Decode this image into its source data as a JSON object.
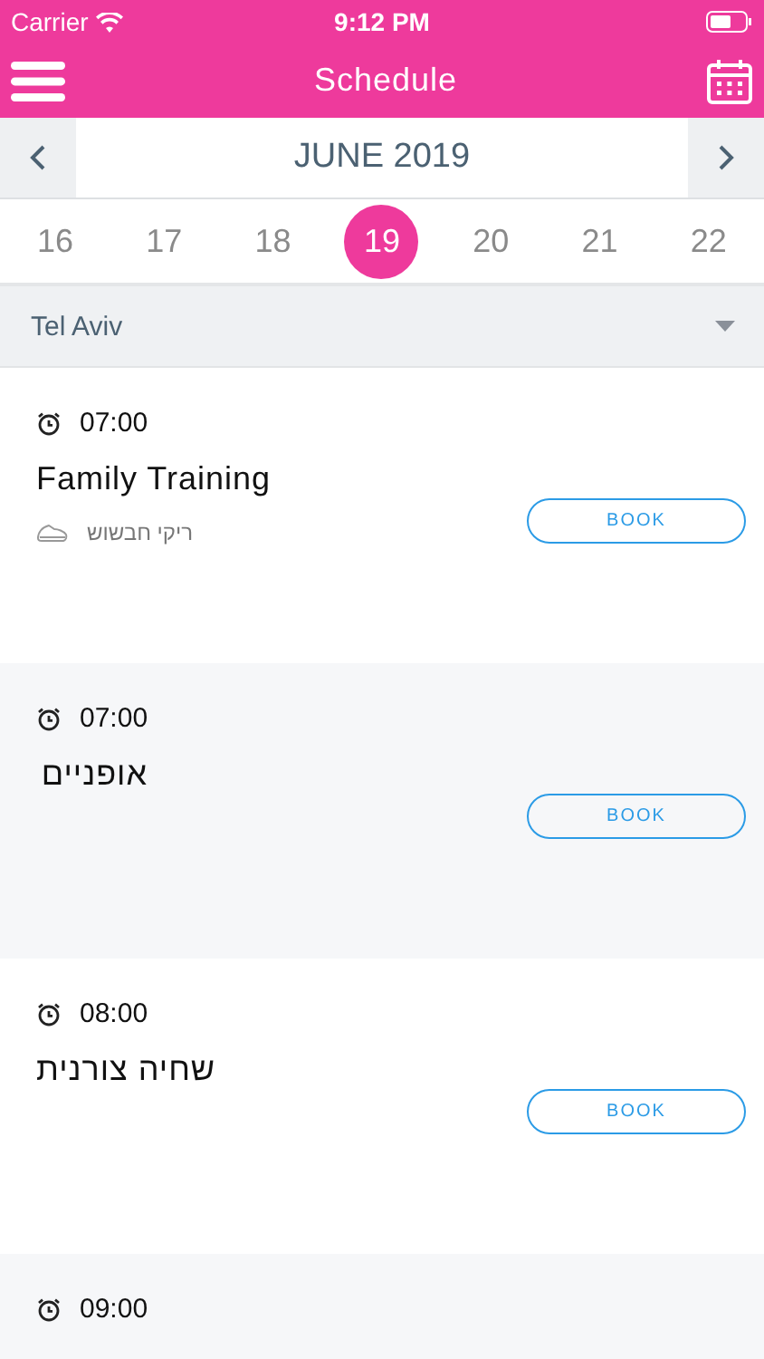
{
  "status_bar": {
    "carrier": "Carrier",
    "time": "9:12 PM"
  },
  "header": {
    "title": "Schedule"
  },
  "month": {
    "label": "JUNE 2019"
  },
  "days": [
    {
      "label": "16",
      "selected": false
    },
    {
      "label": "17",
      "selected": false
    },
    {
      "label": "18",
      "selected": false
    },
    {
      "label": "19",
      "selected": true
    },
    {
      "label": "20",
      "selected": false
    },
    {
      "label": "21",
      "selected": false
    },
    {
      "label": "22",
      "selected": false
    }
  ],
  "location": {
    "value": "Tel Aviv"
  },
  "classes": [
    {
      "time": "07:00",
      "title": "Family Training",
      "instructor": "ריקי חבשוש",
      "button": "BOOK"
    },
    {
      "time": "07:00",
      "title": "אופניים",
      "button": "BOOK"
    },
    {
      "time": "08:00",
      "title": "שחיה צורנית",
      "button": "BOOK"
    },
    {
      "time": "09:00"
    }
  ]
}
